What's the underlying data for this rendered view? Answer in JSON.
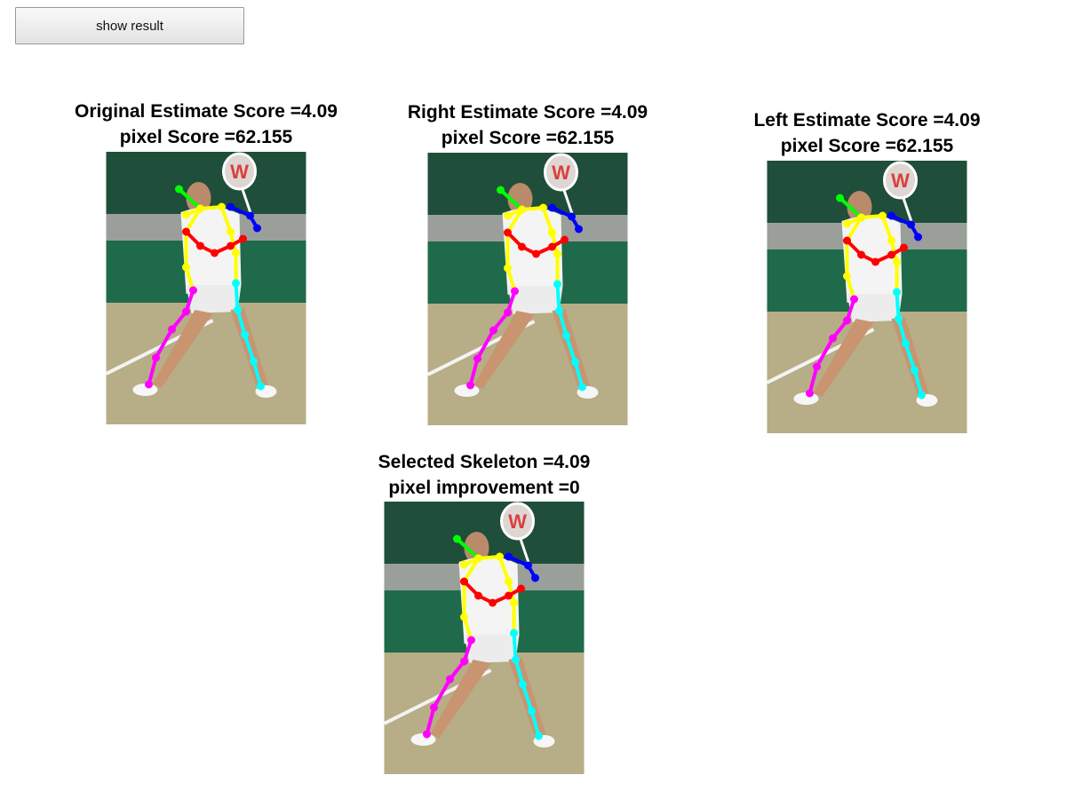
{
  "button": {
    "label": "show result"
  },
  "panels": [
    {
      "title": "Original Estimate Score =4.09",
      "subtitle": "pixel Score =62.155"
    },
    {
      "title": "Right Estimate Score =4.09",
      "subtitle": "pixel Score =62.155"
    },
    {
      "title": "Left Estimate Score =4.09",
      "subtitle": "pixel Score =62.155"
    },
    {
      "title": "Selected Skeleton =4.09",
      "subtitle": "pixel improvement =0"
    }
  ],
  "colors": {
    "head": "#00ff00",
    "torso": "#ffff00",
    "right_arm": "#ff0000",
    "left_arm": "#0000ff",
    "right_leg": "#ff00ff",
    "left_leg": "#00ffff"
  }
}
